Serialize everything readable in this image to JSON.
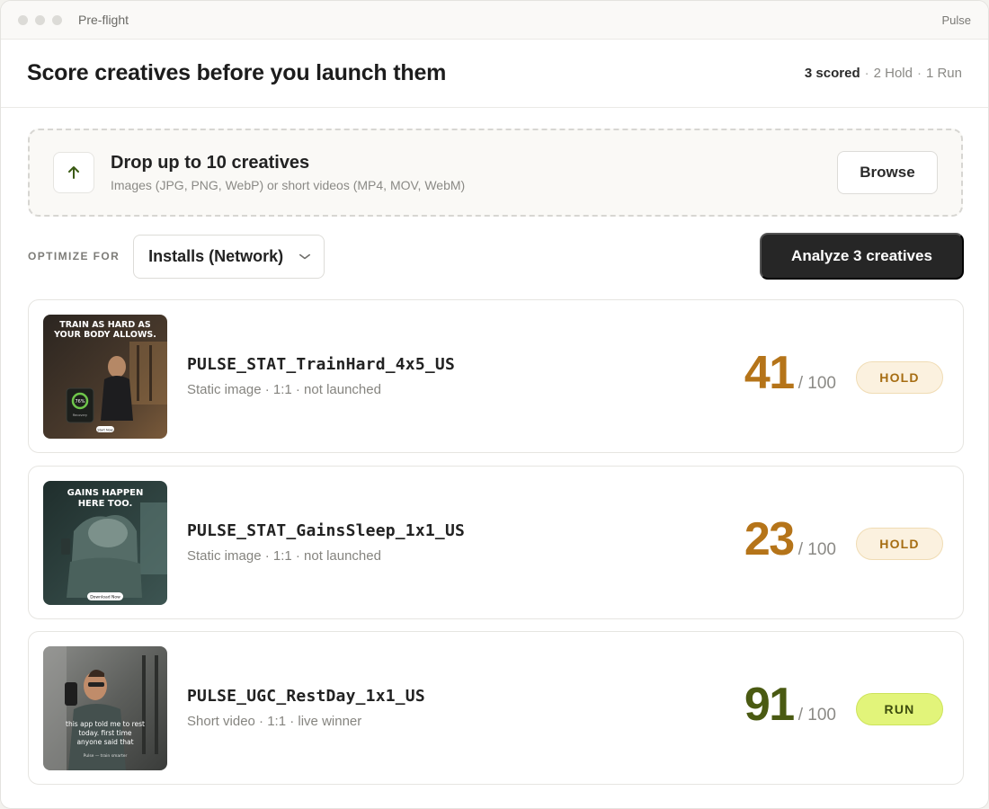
{
  "window": {
    "title": "Pre-flight",
    "app_name": "Pulse"
  },
  "header": {
    "title": "Score creatives before you launch them",
    "summary": {
      "scored": "3 scored",
      "hold": "2 Hold",
      "run": "1 Run",
      "separator": "·"
    }
  },
  "upload": {
    "icon": "arrow-up-icon",
    "title": "Drop up to 10 creatives",
    "subtitle": "Images (JPG, PNG, WebP) or short videos (MP4, MOV, WebM)",
    "browse_label": "Browse"
  },
  "controls": {
    "optimize_label": "OPTIMIZE FOR",
    "selected_goal": "Installs (Network)",
    "analyze_label": "Analyze 3 creatives"
  },
  "creatives": [
    {
      "name": "PULSE_STAT_TrainHard_4x5_US",
      "subtitle": "Static image · 1:1 · not launched",
      "score": "41",
      "score_max": "/ 100",
      "verdict": "HOLD",
      "score_color": "#b57419",
      "thumb_text": [
        "TRAIN AS HARD AS",
        "YOUR BODY ALLOWS."
      ],
      "thumb_ring": "76%",
      "thumb_ring_label": "Recovery",
      "thumb_cta": "Start Now"
    },
    {
      "name": "PULSE_STAT_GainsSleep_1x1_US",
      "subtitle": "Static image · 1:1 · not launched",
      "score": "23",
      "score_max": "/ 100",
      "verdict": "HOLD",
      "score_color": "#b57419",
      "thumb_text": [
        "GAINS HAPPEN",
        "HERE TOO."
      ],
      "thumb_cta": "Download Now"
    },
    {
      "name": "PULSE_UGC_RestDay_1x1_US",
      "subtitle": "Short video · 1:1 · live winner",
      "score": "91",
      "score_max": "/ 100",
      "verdict": "RUN",
      "score_color": "#4a5a12",
      "thumb_text": [
        "this app told me to rest",
        "today. first time",
        "anyone said that"
      ],
      "thumb_cta": "Pulse — train smarter"
    }
  ]
}
